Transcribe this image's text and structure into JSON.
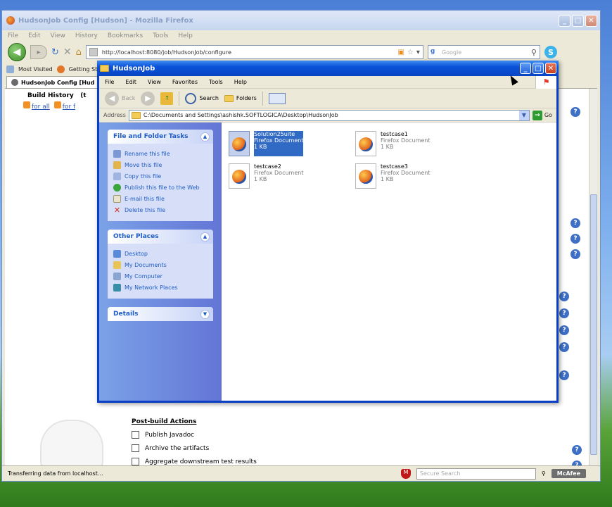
{
  "firefox": {
    "title": "HudsonJob Config [Hudson] - Mozilla Firefox",
    "menu": [
      "File",
      "Edit",
      "View",
      "History",
      "Bookmarks",
      "Tools",
      "Help"
    ],
    "url": "http://localhost:8080/job/HudsonJob/configure",
    "search_placeholder": "Google",
    "bookmarks": [
      "Most Visited",
      "Getting St"
    ],
    "tab_label": "HudsonJob Config [Hud",
    "status": "Transferring data from localhost...",
    "secure_search_placeholder": "Secure Search",
    "mcafee_label": "McAfee"
  },
  "hudson": {
    "sidebar_header": "Build History",
    "sidebar_header_suffix": "(t",
    "rss_links": [
      "for all",
      "for f"
    ],
    "post_build_title": "Post-build Actions",
    "post_build_actions": [
      "Publish Javadoc",
      "Archive the artifacts",
      "Aggregate downstream test results"
    ]
  },
  "explorer": {
    "title": "HudsonJob",
    "menu": [
      "File",
      "Edit",
      "View",
      "Favorites",
      "Tools",
      "Help"
    ],
    "toolbar": {
      "back": "Back",
      "search": "Search",
      "folders": "Folders"
    },
    "address_label": "Address",
    "address": "C:\\Documents and Settings\\ashishk.SOFTLOGICA\\Desktop\\HudsonJob",
    "go_label": "Go",
    "file_folder_tasks": {
      "title": "File and Folder Tasks",
      "items": [
        "Rename this file",
        "Move this file",
        "Copy this file",
        "Publish this file to the Web",
        "E-mail this file",
        "Delete this file"
      ]
    },
    "other_places": {
      "title": "Other Places",
      "items": [
        "Desktop",
        "My Documents",
        "My Computer",
        "My Network Places"
      ]
    },
    "details_title": "Details",
    "files": [
      {
        "name": "Solution25uite",
        "type": "Firefox Document",
        "size": "1 KB"
      },
      {
        "name": "testcase1",
        "type": "Firefox Document",
        "size": "1 KB"
      },
      {
        "name": "testcase2",
        "type": "Firefox Document",
        "size": "1 KB"
      },
      {
        "name": "testcase3",
        "type": "Firefox Document",
        "size": "1 KB"
      }
    ]
  }
}
